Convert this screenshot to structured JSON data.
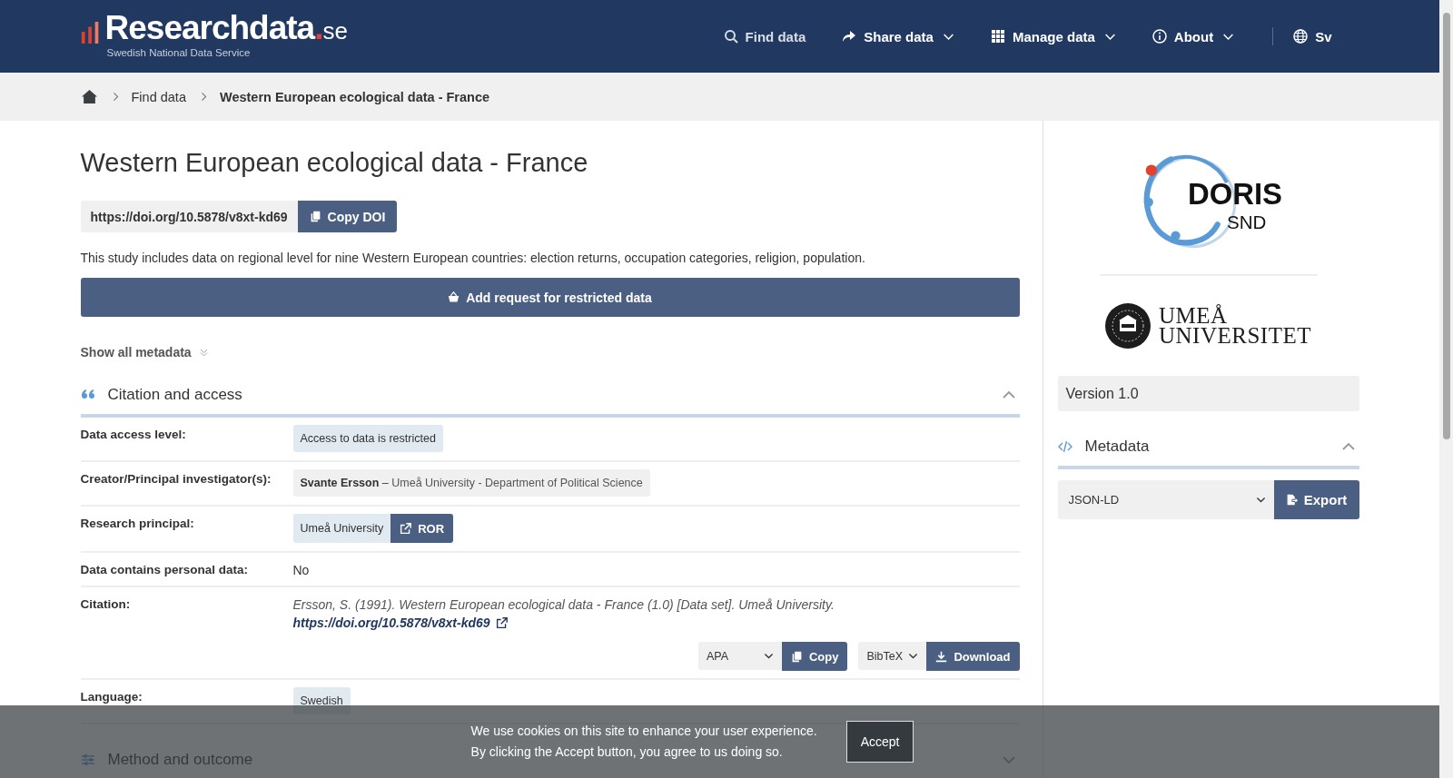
{
  "header": {
    "logo": {
      "name": "Researchdata",
      "dot": ".",
      "tld": "se",
      "tagline": "Swedish National Data Service"
    },
    "nav": [
      {
        "label": "Find data",
        "dropdown": false
      },
      {
        "label": "Share data",
        "dropdown": true
      },
      {
        "label": "Manage data",
        "dropdown": true
      },
      {
        "label": "About",
        "dropdown": true
      }
    ],
    "language": "Sv"
  },
  "breadcrumb": [
    {
      "kind": "home"
    },
    {
      "kind": "link",
      "label": "Find data"
    },
    {
      "kind": "current",
      "label": "Western European ecological data - France"
    }
  ],
  "main": {
    "title": "Western European ecological data - France",
    "doi": {
      "url": "https://doi.org/10.5878/v8xt-kd69",
      "button": "Copy DOI"
    },
    "description": "This study includes data on regional level for nine Western European countries: election returns, occupation categories, religion, population.",
    "request_button": "Add request for restricted data",
    "show_all_metadata": "Show all metadata",
    "sections": [
      {
        "title": "Citation and access",
        "expanded": true,
        "rows": [
          {
            "kind": "tag",
            "label": "Data access level:",
            "value": "Access to data is restricted"
          },
          {
            "kind": "person",
            "label": "Creator/Principal investigator(s):",
            "name": "Svante Ersson",
            "separator": "–",
            "affiliation": "Umeå University - Department of Political Science"
          },
          {
            "kind": "org",
            "label": "Research principal:",
            "name": "Umeå University",
            "link": "ROR"
          },
          {
            "kind": "text",
            "label": "Data contains personal data:",
            "value": "No"
          },
          {
            "kind": "citation",
            "label": "Citation:",
            "text": "Ersson, S. (1991). Western European ecological data - France (1.0) [Data set]. Umeå University.",
            "link": "https://doi.org/10.5878/v8xt-kd69",
            "style": "APA",
            "copy": "Copy",
            "format": "BibTeX",
            "download": "Download"
          },
          {
            "kind": "tag",
            "label": "Language:",
            "value": "Swedish"
          }
        ]
      },
      {
        "title": "Method and outcome",
        "expanded": false
      }
    ]
  },
  "sidebar": {
    "doris_logo": {
      "title": "DORIS",
      "subtitle": "SND"
    },
    "university_logo": {
      "line1": "UMEÅ",
      "line2": "UNIVERSITET"
    },
    "version": "Version 1.0",
    "metadata": {
      "title": "Metadata",
      "expanded": true,
      "format": "JSON-LD",
      "button": "Export"
    }
  },
  "cookie_banner": {
    "lines": [
      "We use cookies on this site to enhance your user experience.",
      "By clicking the Accept button, you agree to us doing so."
    ],
    "button": "Accept"
  }
}
